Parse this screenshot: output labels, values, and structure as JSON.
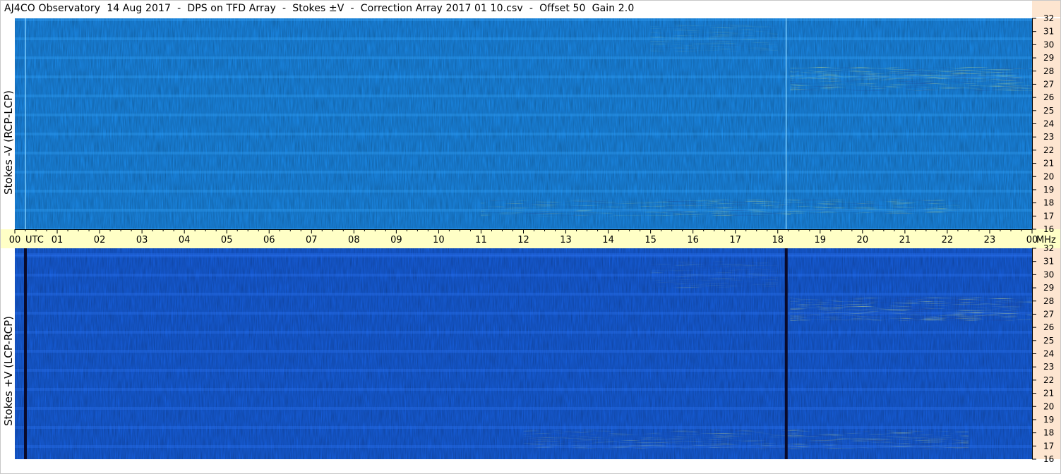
{
  "title": "AJ4CO Observatory  14 Aug 2017  -  DPS on TFD Array  -  Stokes ±V  -  Correction Array 2017 01 10.csv  -  Offset 50  Gain 2.0",
  "chart_data": [
    {
      "type": "heatmap",
      "name": "stokes-minus-v",
      "ylabel": "Stokes -V (RCP-LCP)",
      "x_unit_label": "UTC",
      "x_ticks": [
        "00",
        "01",
        "02",
        "03",
        "04",
        "05",
        "06",
        "07",
        "08",
        "09",
        "10",
        "11",
        "12",
        "13",
        "14",
        "15",
        "16",
        "17",
        "18",
        "19",
        "20",
        "21",
        "22",
        "23",
        "00"
      ],
      "x_end_label": "MHz",
      "xlim": [
        0,
        24
      ],
      "ylim": [
        16,
        32
      ],
      "y_ticks": [
        16,
        17,
        18,
        19,
        20,
        21,
        22,
        23,
        24,
        25,
        26,
        27,
        28,
        29,
        30,
        31,
        32
      ],
      "base_color": "#1b8ef0",
      "activity": [
        {
          "t0": 15.3,
          "t1": 18.3,
          "f0": 17.0,
          "f1": 18.3,
          "level": 0.8
        },
        {
          "t0": 11.0,
          "t1": 15.3,
          "f0": 17.0,
          "f1": 18.2,
          "level": 0.45
        },
        {
          "t0": 18.3,
          "t1": 22.3,
          "f0": 17.2,
          "f1": 18.2,
          "level": 0.7
        },
        {
          "t0": 18.3,
          "t1": 24.0,
          "f0": 26.5,
          "f1": 28.3,
          "level": 0.85
        },
        {
          "t0": 15.0,
          "t1": 18.0,
          "f0": 29.5,
          "f1": 31.5,
          "level": 0.3
        }
      ],
      "vertical_lines_utc": [
        0.25,
        18.2
      ]
    },
    {
      "type": "heatmap",
      "name": "stokes-plus-v",
      "ylabel": "Stokes +V (LCP-RCP)",
      "xlim": [
        0,
        24
      ],
      "ylim": [
        16,
        32
      ],
      "y_ticks": [
        16,
        17,
        18,
        19,
        20,
        21,
        22,
        23,
        24,
        25,
        26,
        27,
        28,
        29,
        30,
        31,
        32
      ],
      "base_color": "#1762e6",
      "activity": [
        {
          "t0": 12.0,
          "t1": 18.3,
          "f0": 16.8,
          "f1": 18.2,
          "level": 0.5
        },
        {
          "t0": 18.3,
          "t1": 22.5,
          "f0": 16.8,
          "f1": 18.2,
          "level": 0.65
        },
        {
          "t0": 18.3,
          "t1": 24.0,
          "f0": 26.5,
          "f1": 28.3,
          "level": 0.8
        },
        {
          "t0": 15.0,
          "t1": 18.0,
          "f0": 29.0,
          "f1": 31.0,
          "level": 0.3
        }
      ],
      "vertical_lines_utc": [
        0.25,
        18.2
      ]
    }
  ],
  "colors": {
    "axis_band": "#ffffc6",
    "right_axis_band": "#fde5d0",
    "dark_line": "#0a0a2a"
  }
}
